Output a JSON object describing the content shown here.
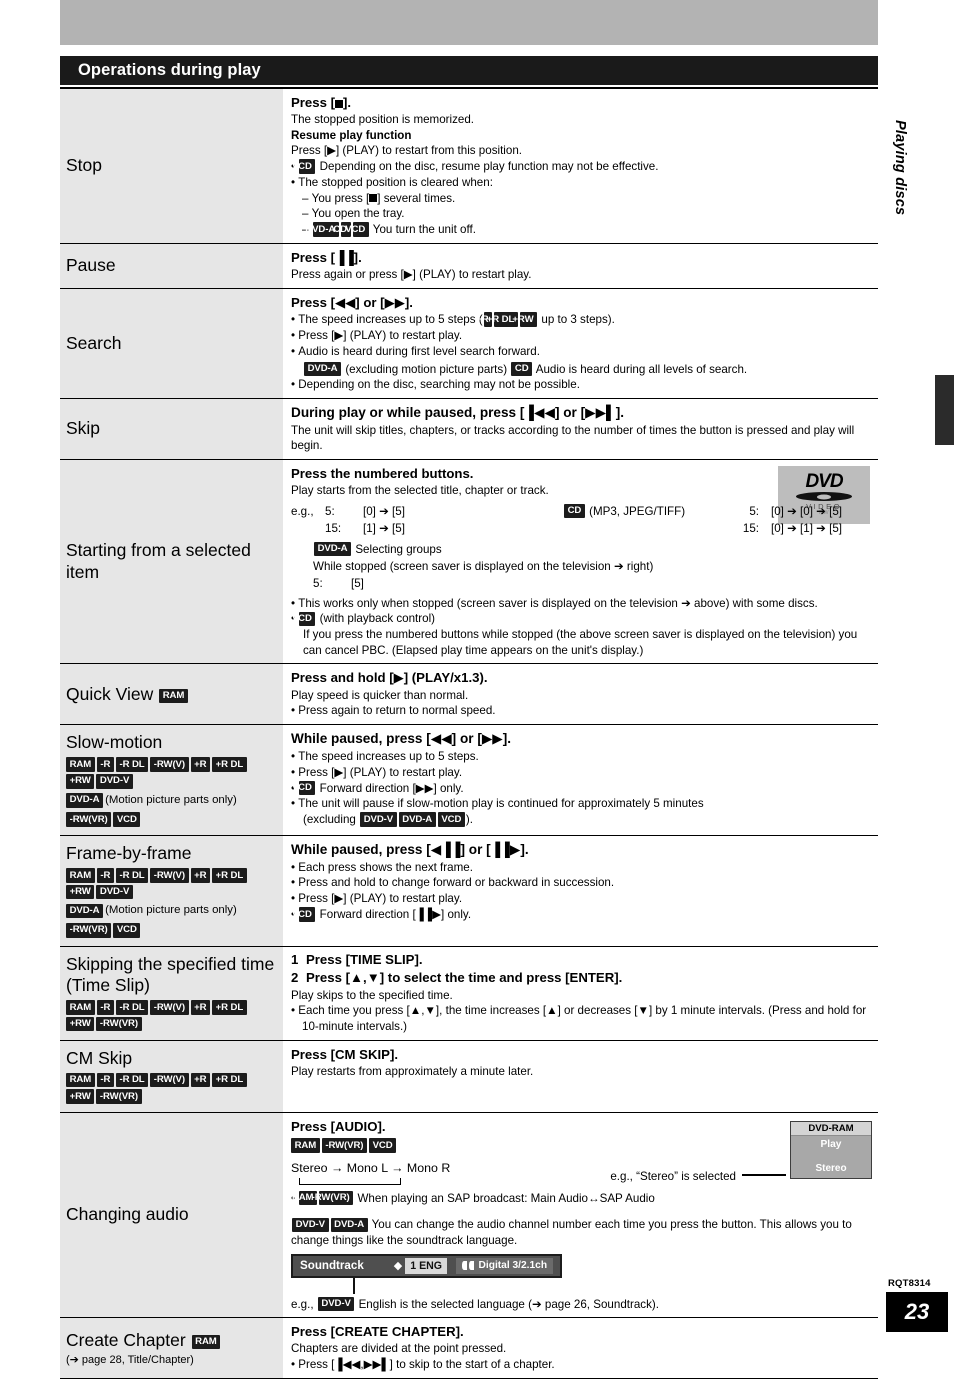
{
  "header": {
    "title": "Operations during play",
    "side_tab": "Playing discs"
  },
  "footer": {
    "code": "RQT8314",
    "page": "23"
  },
  "logo": {
    "dvd": "DVD",
    "video": "VIDEO",
    "sub": "RW"
  },
  "panel": {
    "title": "DVD-RAM",
    "play": "Play",
    "stereo": "Stereo",
    "callout": "e.g., “Stereo” is selected"
  },
  "osd": {
    "label": "Soundtrack",
    "lang": "1 ENG",
    "format": "Digital  3/2.1ch"
  },
  "rows": {
    "stop": {
      "label": "Stop",
      "heading": "Press [■].",
      "l1": "The stopped position is memorized.",
      "l2": "Resume play function",
      "l3": "Press [▶] (PLAY) to restart from this position.",
      "b1_badge": "VCD",
      "b1": "Depending on the disc, resume play function may not be effective.",
      "b2": "The stopped position is cleared when:",
      "d1": "You press [■] several times.",
      "d2": "You open the tray.",
      "d3_badges": [
        "DVD-A",
        "CD",
        "VCD"
      ],
      "d3": "You turn the unit off."
    },
    "pause": {
      "label": "Pause",
      "heading": "Press [▐▐].",
      "l1": "Press again or press [▶] (PLAY) to restart play."
    },
    "search": {
      "label": "Search",
      "heading": "Press [◀◀] or [▶▶].",
      "b1a": "The speed increases up to 5 steps (",
      "b1_badges": [
        "+R",
        "+R DL",
        "+RW"
      ],
      "b1b": "up to 3 steps).",
      "b2": "Press [▶] (PLAY) to restart play.",
      "b3": "Audio is heard during first level search forward.",
      "b4_badge1": "DVD-A",
      "b4a": "(excluding motion picture parts)",
      "b4_badge2": "CD",
      "b4b": "Audio is heard during all levels of search.",
      "b5": "Depending on the disc, searching may not be possible."
    },
    "skip": {
      "label": "Skip",
      "heading": "During play or while paused, press [▐◀◀] or [▶▶▌].",
      "l1": "The unit will skip titles, chapters, or tracks according to the number of times the button is pressed and play will begin."
    },
    "starting": {
      "label": "Starting from a selected item",
      "heading": "Press the numbered buttons.",
      "l1": "Play starts from the selected title, chapter or track.",
      "eg_prefix": "e.g.,",
      "eg_a_n1": "5:",
      "eg_a_v1": "[0] ➔ [5]",
      "eg_a_n2": "15:",
      "eg_a_v2": "[1] ➔ [5]",
      "cd_badge": "CD",
      "cd_note": "(MP3, JPEG/TIFF)",
      "eg_b_n1": "5:",
      "eg_b_v1": "[0] ➔ [0] ➔ [5]",
      "eg_b_n2": "15:",
      "eg_b_v2": "[0] ➔ [1] ➔ [5]",
      "grp_badge": "DVD-A",
      "grp_title": "Selecting groups",
      "grp_l1": "While stopped (screen saver is displayed on the television ➔ right)",
      "grp_n": "5:",
      "grp_v": "[5]",
      "b1": "This works only when stopped (screen saver is displayed on the television ➔ above) with some discs.",
      "b2_badge": "VCD",
      "b2": "(with playback control)",
      "b2_l1": "If you press the numbered buttons while stopped (the above screen saver is displayed on the television) you can cancel PBC. (Elapsed play time appears on the unit's display.)"
    },
    "quickview": {
      "label": "Quick View",
      "label_badge": "RAM",
      "heading": "Press and hold [▶] (PLAY/x1.3).",
      "l1": "Play speed is quicker than normal.",
      "b1": "Press again to return to normal speed."
    },
    "slowmotion": {
      "label": "Slow-motion",
      "badges_1": [
        "RAM",
        "-R",
        "-R DL",
        "-RW(V)",
        "+R",
        "+R DL"
      ],
      "badges_2": [
        "+RW",
        "DVD-V"
      ],
      "badges_3": [
        "DVD-A"
      ],
      "badges_3_note": "(Motion picture parts only)",
      "badges_4": [
        "-RW(VR)",
        "VCD"
      ],
      "heading": "While paused, press [◀◀] or [▶▶].",
      "b1": "The speed increases up to 5 steps.",
      "b2": "Press [▶] (PLAY) to restart play.",
      "b3_badge": "VCD",
      "b3": "Forward direction [▶▶] only.",
      "b4": "The unit will pause if slow-motion play is continued for approximately 5 minutes",
      "b4_excl": "(excluding",
      "b4_badges": [
        "DVD-V",
        "DVD-A",
        "VCD"
      ],
      "b4_end": ")."
    },
    "framebyframe": {
      "label": "Frame-by-frame",
      "badges_1": [
        "RAM",
        "-R",
        "-R DL",
        "-RW(V)",
        "+R",
        "+R DL"
      ],
      "badges_2": [
        "+RW",
        "DVD-V"
      ],
      "badges_3": [
        "DVD-A"
      ],
      "badges_3_note": "(Motion picture parts only)",
      "badges_4": [
        "-RW(VR)",
        "VCD"
      ],
      "heading": "While paused, press [◀▐▐] or [▐▐▶].",
      "b1": "Each press shows the next frame.",
      "b2": "Press and hold to change forward or backward in succession.",
      "b3": "Press [▶] (PLAY) to restart play.",
      "b4_badge": "VCD",
      "b4": "Forward direction [▐▐▶] only."
    },
    "timeslip": {
      "label": "Skipping the specified time (Time Slip)",
      "badges_1": [
        "RAM",
        "-R",
        "-R DL",
        "-RW(V)",
        "+R",
        "+R DL"
      ],
      "badges_2": [
        "+RW",
        "-RW(VR)"
      ],
      "step1_n": "1",
      "step1": "Press [TIME SLIP].",
      "step2_n": "2",
      "step2": "Press [▲,▼] to select the time and press [ENTER].",
      "l1": "Play skips to the specified time.",
      "b1": "Each time you press [▲,▼], the time increases [▲] or decreases [▼] by 1 minute intervals. (Press and hold for 10-minute intervals.)"
    },
    "cmskip": {
      "label": "CM Skip",
      "badges_1": [
        "RAM",
        "-R",
        "-R DL",
        "-RW(V)",
        "+R",
        "+R DL"
      ],
      "badges_2": [
        "+RW",
        "-RW(VR)"
      ],
      "heading": "Press [CM SKIP].",
      "l1": "Play restarts from approximately a minute later."
    },
    "audio": {
      "label": "Changing audio",
      "heading": "Press [AUDIO].",
      "badges_1": [
        "RAM",
        "-RW(VR)",
        "VCD"
      ],
      "cycle": "Stereo → Mono L → Mono R",
      "b1_badges": [
        "RAM",
        "-RW(VR)"
      ],
      "b1": "When playing an SAP broadcast: Main Audio↔SAP Audio",
      "p2_badges": [
        "DVD-V",
        "DVD-A"
      ],
      "p2": "You can change the audio channel number each time you press the button. This allows you to change things like the soundtrack language.",
      "eg_prefix": "e.g.,",
      "eg_badge": "DVD-V",
      "eg_text": "English is the selected language (➔ page 26, Soundtrack)."
    },
    "createchapter": {
      "label": "Create Chapter",
      "label_badge": "RAM",
      "sublabel": "(➔ page 28, Title/Chapter)",
      "heading": "Press [CREATE CHAPTER].",
      "l1": "Chapters are divided at the point pressed.",
      "b1": "Press [▐◀◀,▶▶▌] to skip to the start of a chapter."
    }
  }
}
